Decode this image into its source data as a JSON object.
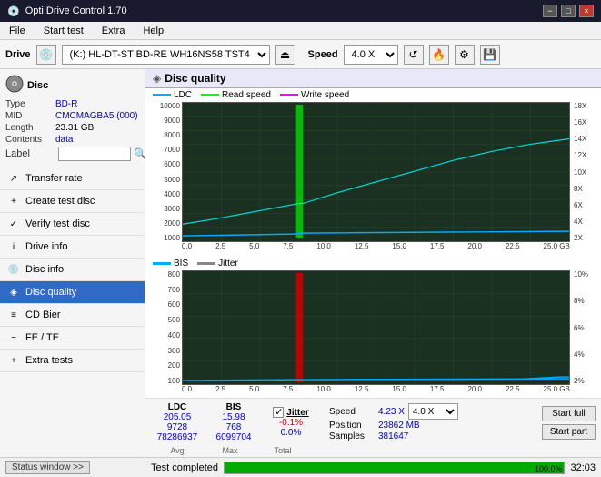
{
  "titlebar": {
    "title": "Opti Drive Control 1.70",
    "icon": "💿",
    "minimize": "−",
    "maximize": "□",
    "close": "×"
  },
  "menu": {
    "items": [
      "File",
      "Start test",
      "Extra",
      "Help"
    ]
  },
  "toolbar": {
    "drive_label": "Drive",
    "drive_value": "(K:) HL-DT-ST BD-RE  WH16NS58 TST4",
    "speed_label": "Speed",
    "speed_value": "4.0 X"
  },
  "disc": {
    "header": "Disc",
    "type_key": "Type",
    "type_val": "BD-R",
    "mid_key": "MID",
    "mid_val": "CMCMAGBA5 (000)",
    "length_key": "Length",
    "length_val": "23.31 GB",
    "contents_key": "Contents",
    "contents_val": "data",
    "label_key": "Label",
    "label_val": ""
  },
  "nav": {
    "items": [
      {
        "id": "transfer-rate",
        "label": "Transfer rate",
        "icon": "↗"
      },
      {
        "id": "create-test-disc",
        "label": "Create test disc",
        "icon": "+"
      },
      {
        "id": "verify-test-disc",
        "label": "Verify test disc",
        "icon": "✓"
      },
      {
        "id": "drive-info",
        "label": "Drive info",
        "icon": "i"
      },
      {
        "id": "disc-info",
        "label": "Disc info",
        "icon": "💿"
      },
      {
        "id": "disc-quality",
        "label": "Disc quality",
        "icon": "◈",
        "active": true
      },
      {
        "id": "cd-bier",
        "label": "CD Bier",
        "icon": "≡"
      },
      {
        "id": "fe-te",
        "label": "FE / TE",
        "icon": "~"
      },
      {
        "id": "extra-tests",
        "label": "Extra tests",
        "icon": "+"
      }
    ]
  },
  "chart": {
    "title": "Disc quality",
    "icon": "◈",
    "legend": {
      "ldc_label": "LDC",
      "ldc_color": "#00aaff",
      "read_label": "Read speed",
      "read_color": "#00ff00",
      "write_label": "Write speed",
      "write_color": "#ff00ff"
    },
    "legend2": {
      "bis_label": "BIS",
      "bis_color": "#00aaff",
      "jitter_label": "Jitter",
      "jitter_color": "#888"
    },
    "top_y_right": [
      "18X",
      "16X",
      "14X",
      "12X",
      "10X",
      "8X",
      "6X",
      "4X",
      "2X"
    ],
    "top_y_left": [
      "10000",
      "9000",
      "8000",
      "7000",
      "6000",
      "5000",
      "4000",
      "3000",
      "2000",
      "1000"
    ],
    "x_labels": [
      "0.0",
      "2.5",
      "5.0",
      "7.5",
      "10.0",
      "12.5",
      "15.0",
      "17.5",
      "20.0",
      "22.5",
      "25.0"
    ],
    "bottom_y_right": [
      "10%",
      "8%",
      "6%",
      "4%",
      "2%"
    ],
    "bottom_y_left": [
      "800",
      "700",
      "600",
      "500",
      "400",
      "300",
      "200",
      "100"
    ]
  },
  "stats": {
    "ldc_header": "LDC",
    "bis_header": "BIS",
    "jitter_header": "Jitter",
    "avg_label": "Avg",
    "max_label": "Max",
    "total_label": "Total",
    "ldc_avg": "205.05",
    "ldc_max": "9728",
    "ldc_total": "78286937",
    "bis_avg": "15.98",
    "bis_max": "768",
    "bis_total": "6099704",
    "jitter_checked": true,
    "jitter_avg": "-0.1%",
    "jitter_max": "0.0%",
    "jitter_total": "",
    "speed_label": "Speed",
    "speed_val": "4.23 X",
    "speed_select": "4.0 X",
    "position_label": "Position",
    "position_val": "23862 MB",
    "samples_label": "Samples",
    "samples_val": "381647",
    "btn_start_full": "Start full",
    "btn_start_part": "Start part"
  },
  "statusbar": {
    "btn_label": "Status window >>",
    "status_text": "Test completed",
    "progress_pct": 100,
    "progress_text": "100.0%",
    "time_text": "32:03"
  }
}
